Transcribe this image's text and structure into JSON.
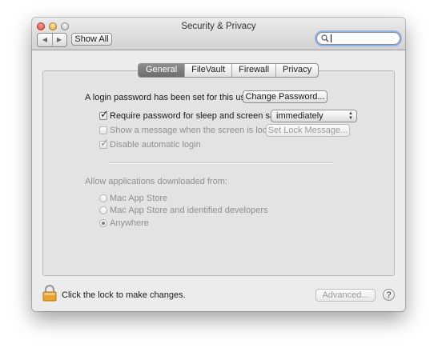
{
  "window": {
    "title": "Security & Privacy"
  },
  "toolbar": {
    "back": "◀",
    "forward": "▶",
    "show_all_label": "Show All",
    "search_placeholder": ""
  },
  "tabs": [
    {
      "label": "General",
      "selected": true
    },
    {
      "label": "FileVault",
      "selected": false
    },
    {
      "label": "Firewall",
      "selected": false
    },
    {
      "label": "Privacy",
      "selected": false
    }
  ],
  "general": {
    "login_password_text": "A login password has been set for this user",
    "change_password_label": "Change Password...",
    "require_password": {
      "label": "Require password for sleep and screen saver",
      "checked": true,
      "enabled": true
    },
    "require_delay": {
      "value": "immediately"
    },
    "show_message": {
      "label": "Show a message when the screen is locked",
      "checked": false,
      "enabled": false
    },
    "set_lock_message_label": "Set Lock Message...",
    "disable_auto_login": {
      "label": "Disable automatic login",
      "checked": true,
      "enabled": false
    },
    "allow_apps_title": "Allow applications downloaded from:",
    "allow_options": [
      {
        "label": "Mac App Store",
        "selected": false
      },
      {
        "label": "Mac App Store and identified developers",
        "selected": false
      },
      {
        "label": "Anywhere",
        "selected": true
      }
    ]
  },
  "footer": {
    "lock_text": "Click the lock to make changes.",
    "advanced_label": "Advanced...",
    "help_label": "?"
  },
  "colors": {
    "lock": "#e8a431",
    "tab_selected": "#7d7d7d",
    "search_focus": "#8fb4e8"
  }
}
